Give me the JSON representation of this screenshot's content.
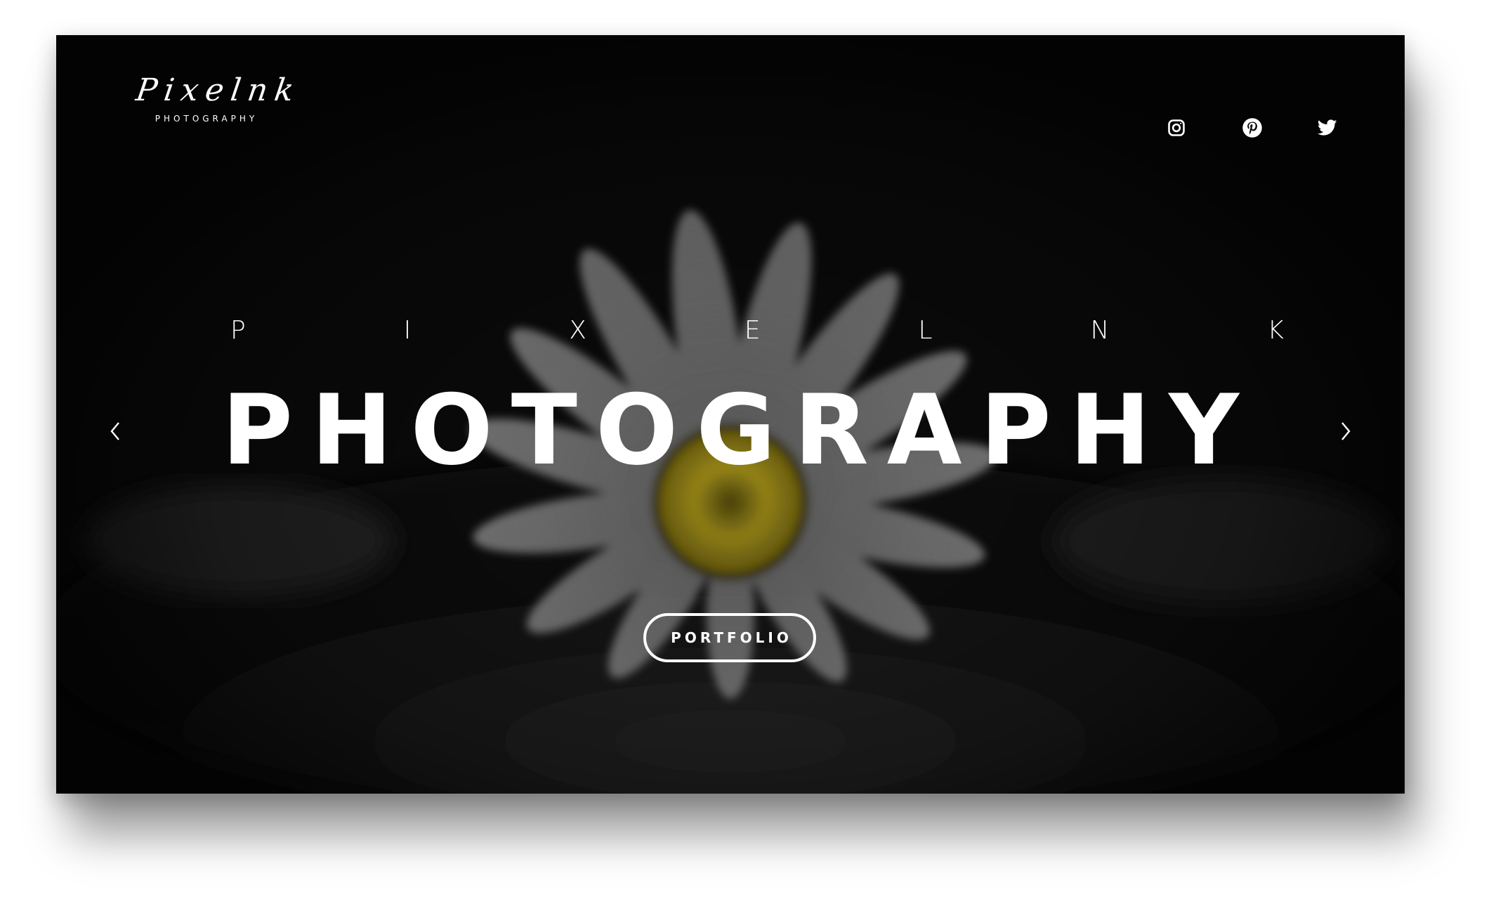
{
  "brand": {
    "script_name": "Pixelnk",
    "subtitle": "PHOTOGRAPHY"
  },
  "social": [
    {
      "icon": "instagram-icon"
    },
    {
      "icon": "pinterest-icon"
    },
    {
      "icon": "twitter-icon"
    }
  ],
  "hero": {
    "kicker_letters": [
      "P",
      "I",
      "X",
      "E",
      "L",
      "N",
      "K"
    ],
    "headline": "PHOTOGRAPHY",
    "cta_label": "PORTFOLIO",
    "background": "daisy flower on dark background",
    "prev_icon": "chevron-left-icon",
    "next_icon": "chevron-right-icon"
  },
  "colors": {
    "background": "#0b0b0b",
    "text": "#ffffff",
    "accent_flower_center": "#a7921a"
  }
}
